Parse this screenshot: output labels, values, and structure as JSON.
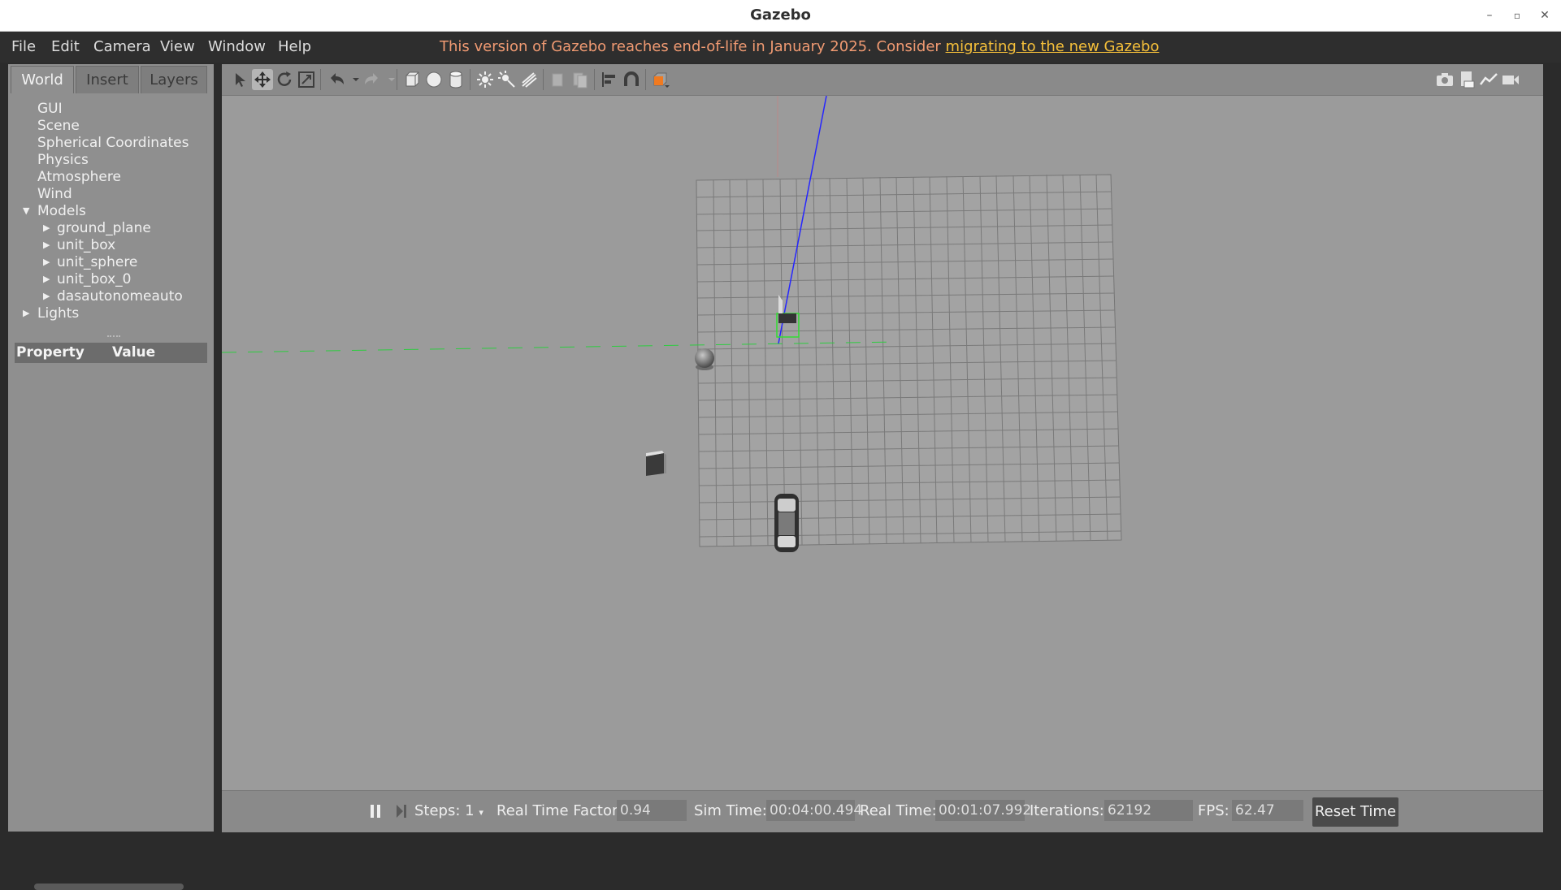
{
  "window": {
    "title": "Gazebo"
  },
  "menu": {
    "file": "File",
    "edit": "Edit",
    "camera": "Camera",
    "view": "View",
    "window": "Window",
    "help": "Help",
    "eol_notice": "This version of Gazebo reaches end-of-life in January 2025. Consider ",
    "eol_link": "migrating to the new Gazebo"
  },
  "left_panel": {
    "tabs": [
      "World",
      "Insert",
      "Layers"
    ],
    "active_tab": "World",
    "tree": {
      "gui": "GUI",
      "scene": "Scene",
      "spherical": "Spherical Coordinates",
      "physics": "Physics",
      "atmosphere": "Atmosphere",
      "wind": "Wind",
      "models": "Models",
      "model_items": [
        "ground_plane",
        "unit_box",
        "unit_sphere",
        "unit_box_0",
        "dasautonomeauto"
      ],
      "lights": "Lights"
    },
    "property_header": {
      "property": "Property",
      "value": "Value"
    }
  },
  "toolbar": {
    "tools": [
      "select-arrow-icon",
      "translate-icon",
      "rotate-icon",
      "scale-icon",
      "undo-icon",
      "redo-icon",
      "box-icon",
      "sphere-icon",
      "cylinder-icon",
      "point-light-icon",
      "spot-light-icon",
      "directional-light-icon",
      "copy-icon",
      "paste-icon",
      "align-icon",
      "snap-icon",
      "view-angle-icon",
      "screenshot-icon",
      "log-icon",
      "plot-icon",
      "video-record-icon"
    ],
    "active_tool": "translate-icon"
  },
  "status_bar": {
    "steps_label": "Steps: 1",
    "rtf_label": "Real Time Factor:",
    "rtf_value": "0.94",
    "sim_time_label": "Sim Time:",
    "sim_time_value": "00:04:00.494",
    "real_time_label": "Real Time:",
    "real_time_value": "00:01:07.992",
    "iterations_label": "Iterations:",
    "iterations_value": "62192",
    "fps_label": "FPS:",
    "fps_value": "62.47",
    "reset_label": "Reset Time"
  },
  "colors": {
    "eol_text": "#f09a72",
    "eol_link": "#f6c03a",
    "x_axis": "#00cc00",
    "z_axis": "#2020ff",
    "selection": "#33dd33",
    "record_icon": "#f07a20"
  }
}
